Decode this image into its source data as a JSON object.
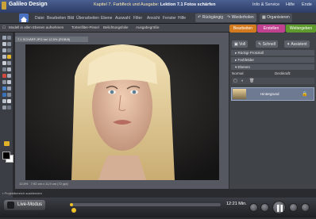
{
  "app": {
    "brand": "Galileo Design",
    "course_prefix": "Kapitel 7. Farbfleck und Ausgabe:",
    "course_lesson": "Lektion 7.1 Fotos schärfen"
  },
  "topnav": {
    "info": "Info & Service",
    "help": "Hilfe",
    "end": "Ende"
  },
  "menus": [
    "Datei",
    "Bearbeiten",
    "Bild",
    "Überarbeiten",
    "Ebene",
    "Auswahl",
    "Filter",
    "Ansicht",
    "Fenster",
    "Hilfe"
  ],
  "menu_buttons": {
    "undo": "Rückgängig",
    "redo": "Wiederholen",
    "organizer": "Organisieren"
  },
  "options": {
    "note": "Modell in allen Ebenen aufnehmen",
    "a": "Tortenfilter-Pinsel",
    "b": "Belichtungsfolie",
    "c": "Ausgabegröße"
  },
  "right_tabs": {
    "edit": "Bearbeiten",
    "create": "Erstellen",
    "share": "Weitergeben"
  },
  "right_buttons": {
    "full": "Voll",
    "quick": "Schnell",
    "assisted": "Assistent"
  },
  "sections": {
    "undo_history": "Rückgi-Protokoll",
    "color_swatches": "Farbfelder",
    "layers": "Ebenen"
  },
  "layers": {
    "normal": "Normal",
    "opacity": "Deckkraft:",
    "background_layer": "Hintergrund"
  },
  "document": {
    "tab": "7.1 SCHÄRF.JPG bei 12,5% (RGB/8)",
    "zoom": "12,5%",
    "info": "7,92 cm x 11,9 cm (72 ppi)"
  },
  "project_note": "Projektbereich ausblenden",
  "player": {
    "live": "Live-Modus",
    "time": "12:21 Min.",
    "progress_fraction": 0.01
  },
  "colors": {
    "accent": "#f0c02a",
    "tab_edit": "#d47a1e",
    "tab_create": "#c0418f",
    "tab_share": "#5f9a2d",
    "home": "#4b71c2"
  }
}
